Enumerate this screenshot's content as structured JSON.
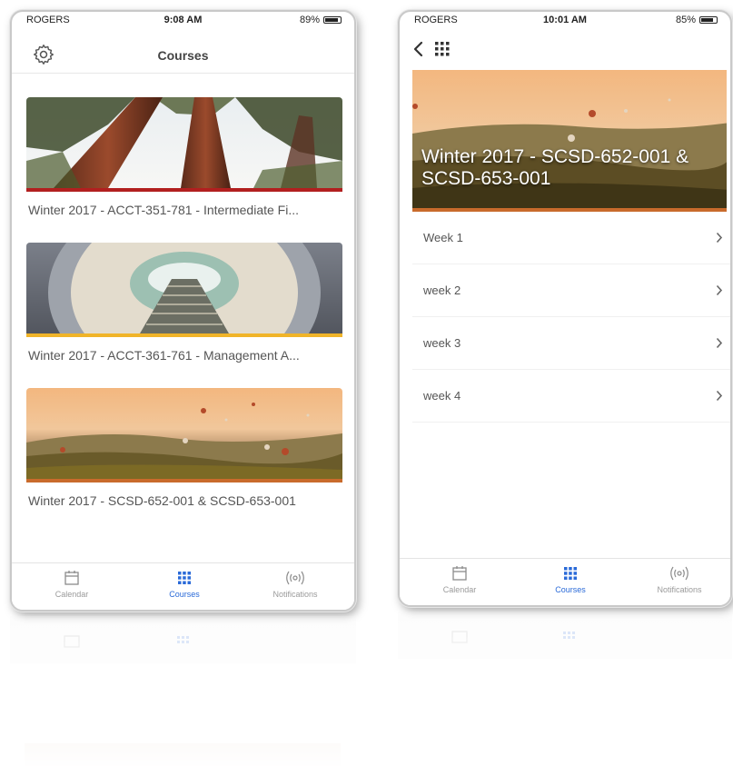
{
  "left_screen": {
    "status": {
      "carrier": "ROGERS",
      "time": "9:08 AM",
      "battery": "89%",
      "battery_level": 0.89
    },
    "nav_title": "Courses",
    "courses": [
      {
        "title": "Winter 2017 - ACCT-351-781 - Intermediate Fi...",
        "stripe_color": "#b21f1f"
      },
      {
        "title": "Winter 2017 - ACCT-361-761 - Management A...",
        "stripe_color": "#f0b429"
      },
      {
        "title": "Winter 2017 - SCSD-652-001 & SCSD-653-001",
        "stripe_color": "#c96b2c"
      }
    ],
    "tabs": [
      {
        "label": "Calendar",
        "icon": "calendar-icon"
      },
      {
        "label": "Courses",
        "icon": "grid-icon"
      },
      {
        "label": "Notifications",
        "icon": "broadcast-icon"
      }
    ]
  },
  "right_screen": {
    "status": {
      "carrier": "ROGERS",
      "time": "10:01 AM",
      "battery": "85%",
      "battery_level": 0.85
    },
    "course_title": "Winter 2017 - SCSD-652-001 & SCSD-653-001",
    "weeks": [
      {
        "label": "Week 1"
      },
      {
        "label": "week 2"
      },
      {
        "label": "week 3"
      },
      {
        "label": "week 4"
      }
    ],
    "tabs": [
      {
        "label": "Calendar",
        "icon": "calendar-icon"
      },
      {
        "label": "Courses",
        "icon": "grid-icon"
      },
      {
        "label": "Notifications",
        "icon": "broadcast-icon"
      }
    ]
  },
  "colors": {
    "accent": "#2a6ad8",
    "text": "#555555",
    "icon_gray": "#8c8c8c"
  }
}
